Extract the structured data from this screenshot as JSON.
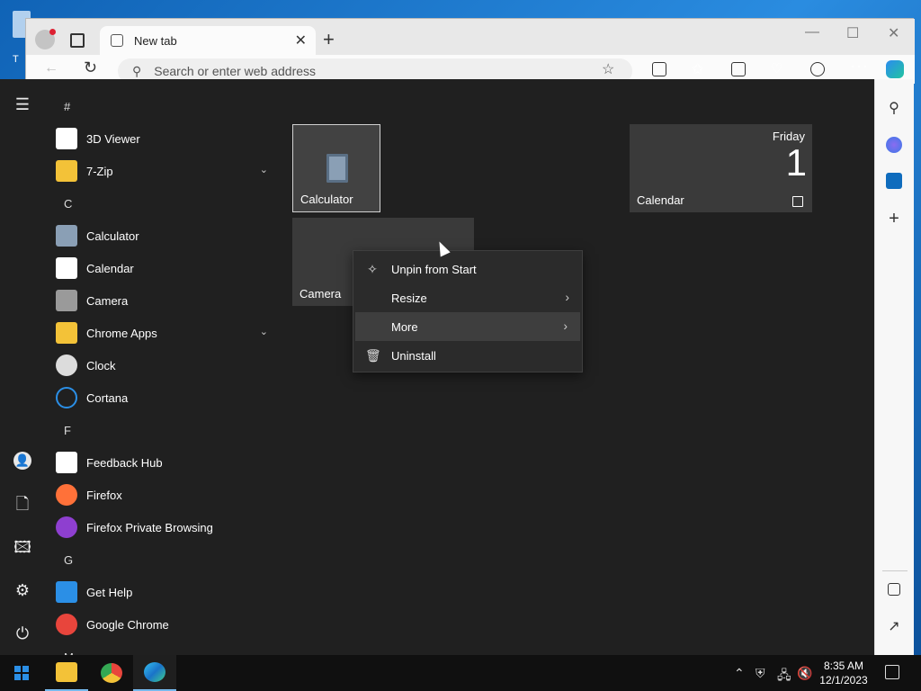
{
  "desktop": {
    "icon_label": "T"
  },
  "browser": {
    "tab_title": "New tab",
    "tab_close": "✕",
    "new_tab": "+",
    "window_controls": {
      "minimize": "—",
      "maximize": "☐",
      "close": "✕"
    },
    "address_placeholder": "Search or enter web address",
    "more": "···",
    "sidebar_add": "+"
  },
  "start_menu": {
    "groups": [
      {
        "letter": "#",
        "apps": [
          {
            "name": "3D Viewer",
            "icon": "cube-icon",
            "color": "#ffffff"
          },
          {
            "name": "7-Zip",
            "icon": "folder-icon",
            "color": "#f3c238",
            "expandable": true
          }
        ]
      },
      {
        "letter": "C",
        "apps": [
          {
            "name": "Calculator",
            "icon": "calculator-icon",
            "color": "#8a9fb5"
          },
          {
            "name": "Calendar",
            "icon": "calendar-icon",
            "color": "#ffffff"
          },
          {
            "name": "Camera",
            "icon": "camera-icon",
            "color": "#9a9a9a"
          },
          {
            "name": "Chrome Apps",
            "icon": "folder-icon",
            "color": "#f3c238",
            "expandable": true
          },
          {
            "name": "Clock",
            "icon": "clock-icon",
            "color": "#dcdcdc"
          },
          {
            "name": "Cortana",
            "icon": "cortana-icon",
            "color": "#2b8fe6"
          }
        ]
      },
      {
        "letter": "F",
        "apps": [
          {
            "name": "Feedback Hub",
            "icon": "feedback-icon",
            "color": "#ffffff"
          },
          {
            "name": "Firefox",
            "icon": "firefox-icon",
            "color": "#ff7139"
          },
          {
            "name": "Firefox Private Browsing",
            "icon": "firefox-private-icon",
            "color": "#8e3fd0"
          }
        ]
      },
      {
        "letter": "G",
        "apps": [
          {
            "name": "Get Help",
            "icon": "get-help-icon",
            "color": "#2b8fe6"
          },
          {
            "name": "Google Chrome",
            "icon": "chrome-icon",
            "color": "#e8453c"
          }
        ]
      },
      {
        "letter": "M",
        "apps": []
      }
    ],
    "tiles": {
      "calculator": "Calculator",
      "camera": "Camera",
      "calendar": {
        "label": "Calendar",
        "day": "Friday",
        "date": "1"
      }
    },
    "context_menu": [
      {
        "label": "Unpin from Start",
        "icon": "unpin-icon",
        "submenu": false
      },
      {
        "label": "Resize",
        "icon": "",
        "submenu": true
      },
      {
        "label": "More",
        "icon": "",
        "submenu": true,
        "hovered": true
      },
      {
        "label": "Uninstall",
        "icon": "trash-icon",
        "submenu": false
      }
    ]
  },
  "taskbar": {
    "time": "8:35 AM",
    "date": "12/1/2023"
  }
}
